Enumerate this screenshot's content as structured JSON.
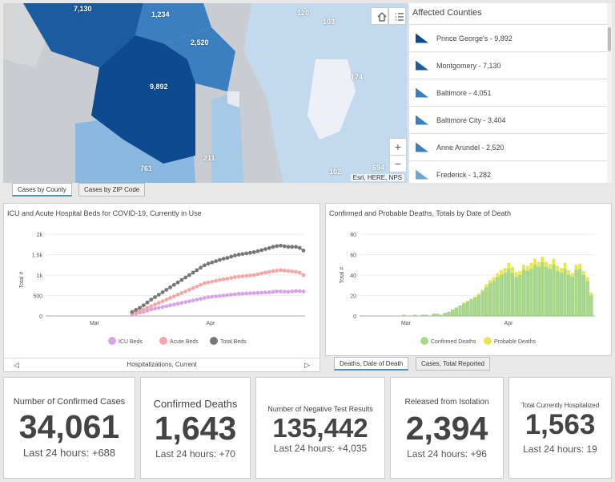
{
  "map": {
    "labels": [
      "7,130",
      "1,234",
      "2,520",
      "9,892",
      "103",
      "174",
      "211",
      "761",
      "102",
      "694",
      "120"
    ],
    "attribution": "Esri, HERE, NPS",
    "home_icon": "home-icon",
    "list_icon": "list-icon",
    "zoom_in": "+",
    "zoom_out": "−"
  },
  "legend": {
    "title": "Affected Counties",
    "items": [
      {
        "label": "Prince George's - 9,892",
        "color": "#0d4a8f"
      },
      {
        "label": "Montgomery - 7,130",
        "color": "#1b5ca0"
      },
      {
        "label": "Baltimore - 4,051",
        "color": "#3b7fc0"
      },
      {
        "label": "Baltimore City - 3,404",
        "color": "#3b7fc0"
      },
      {
        "label": "Anne Arundel - 2,520",
        "color": "#3b7fc0"
      },
      {
        "label": "Frederick - 1,282",
        "color": "#6aa6d8"
      }
    ]
  },
  "map_tabs": [
    "Cases by County",
    "Cases by ZIP Code"
  ],
  "hosp_chart": {
    "title": "ICU and Acute Hospital Beds for COVID-19, Currently in Use",
    "footer": "Hospitalizations, Current",
    "prev_icon": "left-arrow-icon",
    "next_icon": "right-arrow-icon",
    "chart_data": {
      "type": "line",
      "xlabel": "",
      "ylabel": "Total #",
      "ylim": [
        0,
        2000
      ],
      "yticks": [
        "0",
        "500",
        "1k",
        "1.5k",
        "2k"
      ],
      "xticks": [
        "Mar",
        "Apr"
      ],
      "series": [
        {
          "name": "ICU Beds",
          "color": "#d9a3e8",
          "values": [
            40,
            60,
            80,
            100,
            130,
            160,
            180,
            200,
            220,
            240,
            260,
            280,
            300,
            320,
            340,
            360,
            380,
            400,
            420,
            440,
            460,
            470,
            480,
            490,
            500,
            510,
            520,
            530,
            540,
            545,
            550,
            555,
            560,
            565,
            570,
            575,
            580,
            590,
            600,
            600,
            595,
            590,
            600,
            610,
            605,
            600
          ]
        },
        {
          "name": "Acute Beds",
          "color": "#f4a7a7",
          "values": [
            60,
            90,
            120,
            160,
            200,
            240,
            280,
            320,
            360,
            400,
            440,
            480,
            520,
            560,
            600,
            640,
            680,
            720,
            760,
            800,
            820,
            840,
            860,
            880,
            900,
            910,
            930,
            950,
            960,
            970,
            980,
            990,
            1000,
            1020,
            1040,
            1060,
            1080,
            1100,
            1110,
            1120,
            1110,
            1100,
            1090,
            1080,
            1060,
            1000
          ]
        },
        {
          "name": "Total Beds",
          "color": "#777777",
          "values": [
            100,
            150,
            200,
            260,
            330,
            400,
            460,
            520,
            580,
            640,
            700,
            760,
            820,
            880,
            940,
            1000,
            1060,
            1120,
            1180,
            1240,
            1280,
            1310,
            1340,
            1370,
            1400,
            1420,
            1450,
            1480,
            1500,
            1515,
            1530,
            1545,
            1560,
            1585,
            1610,
            1635,
            1660,
            1690,
            1710,
            1720,
            1705,
            1690,
            1690,
            1690,
            1665,
            1600
          ]
        }
      ]
    }
  },
  "deaths_chart": {
    "title": "Confirmed and Probable Deaths, Totals by Date of Death",
    "chart_data": {
      "type": "bar",
      "xlabel": "",
      "ylabel": "Total #",
      "ylim": [
        0,
        80
      ],
      "yticks": [
        "0",
        "20",
        "40",
        "60",
        "80"
      ],
      "xticks": [
        "Mar",
        "Apr"
      ],
      "series": [
        {
          "name": "Confirmed Deaths",
          "color": "#a8d98a",
          "values": [
            0,
            0,
            0,
            0,
            0,
            1,
            0,
            0,
            1,
            0,
            1,
            1,
            0,
            2,
            2,
            1,
            3,
            4,
            6,
            8,
            10,
            12,
            14,
            16,
            18,
            20,
            24,
            28,
            32,
            34,
            38,
            40,
            42,
            46,
            42,
            38,
            40,
            45,
            44,
            46,
            50,
            48,
            52,
            48,
            46,
            50,
            44,
            42,
            46,
            40,
            38,
            45,
            46,
            40,
            34,
            20
          ]
        },
        {
          "name": "Probable Deaths",
          "color": "#e8e64a",
          "values": [
            0,
            0,
            0,
            0,
            0,
            0,
            0,
            0,
            0,
            0,
            0,
            0,
            0,
            0,
            0,
            0,
            0,
            0,
            0,
            0,
            0,
            1,
            1,
            1,
            1,
            2,
            2,
            3,
            3,
            4,
            4,
            5,
            5,
            6,
            6,
            5,
            4,
            5,
            5,
            6,
            6,
            5,
            6,
            5,
            5,
            6,
            5,
            5,
            6,
            5,
            4,
            5,
            5,
            4,
            4,
            3
          ]
        }
      ]
    }
  },
  "chart_tabs": [
    "Deaths, Date of Death",
    "Cases, Total Reported"
  ],
  "stats": [
    {
      "label": "Number of Confirmed Cases",
      "value": "34,061",
      "sub": "Last 24 hours: +688"
    },
    {
      "label": "Confirmed Deaths",
      "value": "1,643",
      "sub": "Last 24 hours: +70"
    },
    {
      "label": "Number of Negative Test Results",
      "value": "135,442",
      "sub": "Last 24 hours: +4,035"
    },
    {
      "label": "Released from Isolation",
      "value": "2,394",
      "sub": "Last 24 hours: +96"
    },
    {
      "label": "Total Currently Hospitalized",
      "value": "1,563",
      "sub": "Last 24 hours: 19"
    }
  ]
}
